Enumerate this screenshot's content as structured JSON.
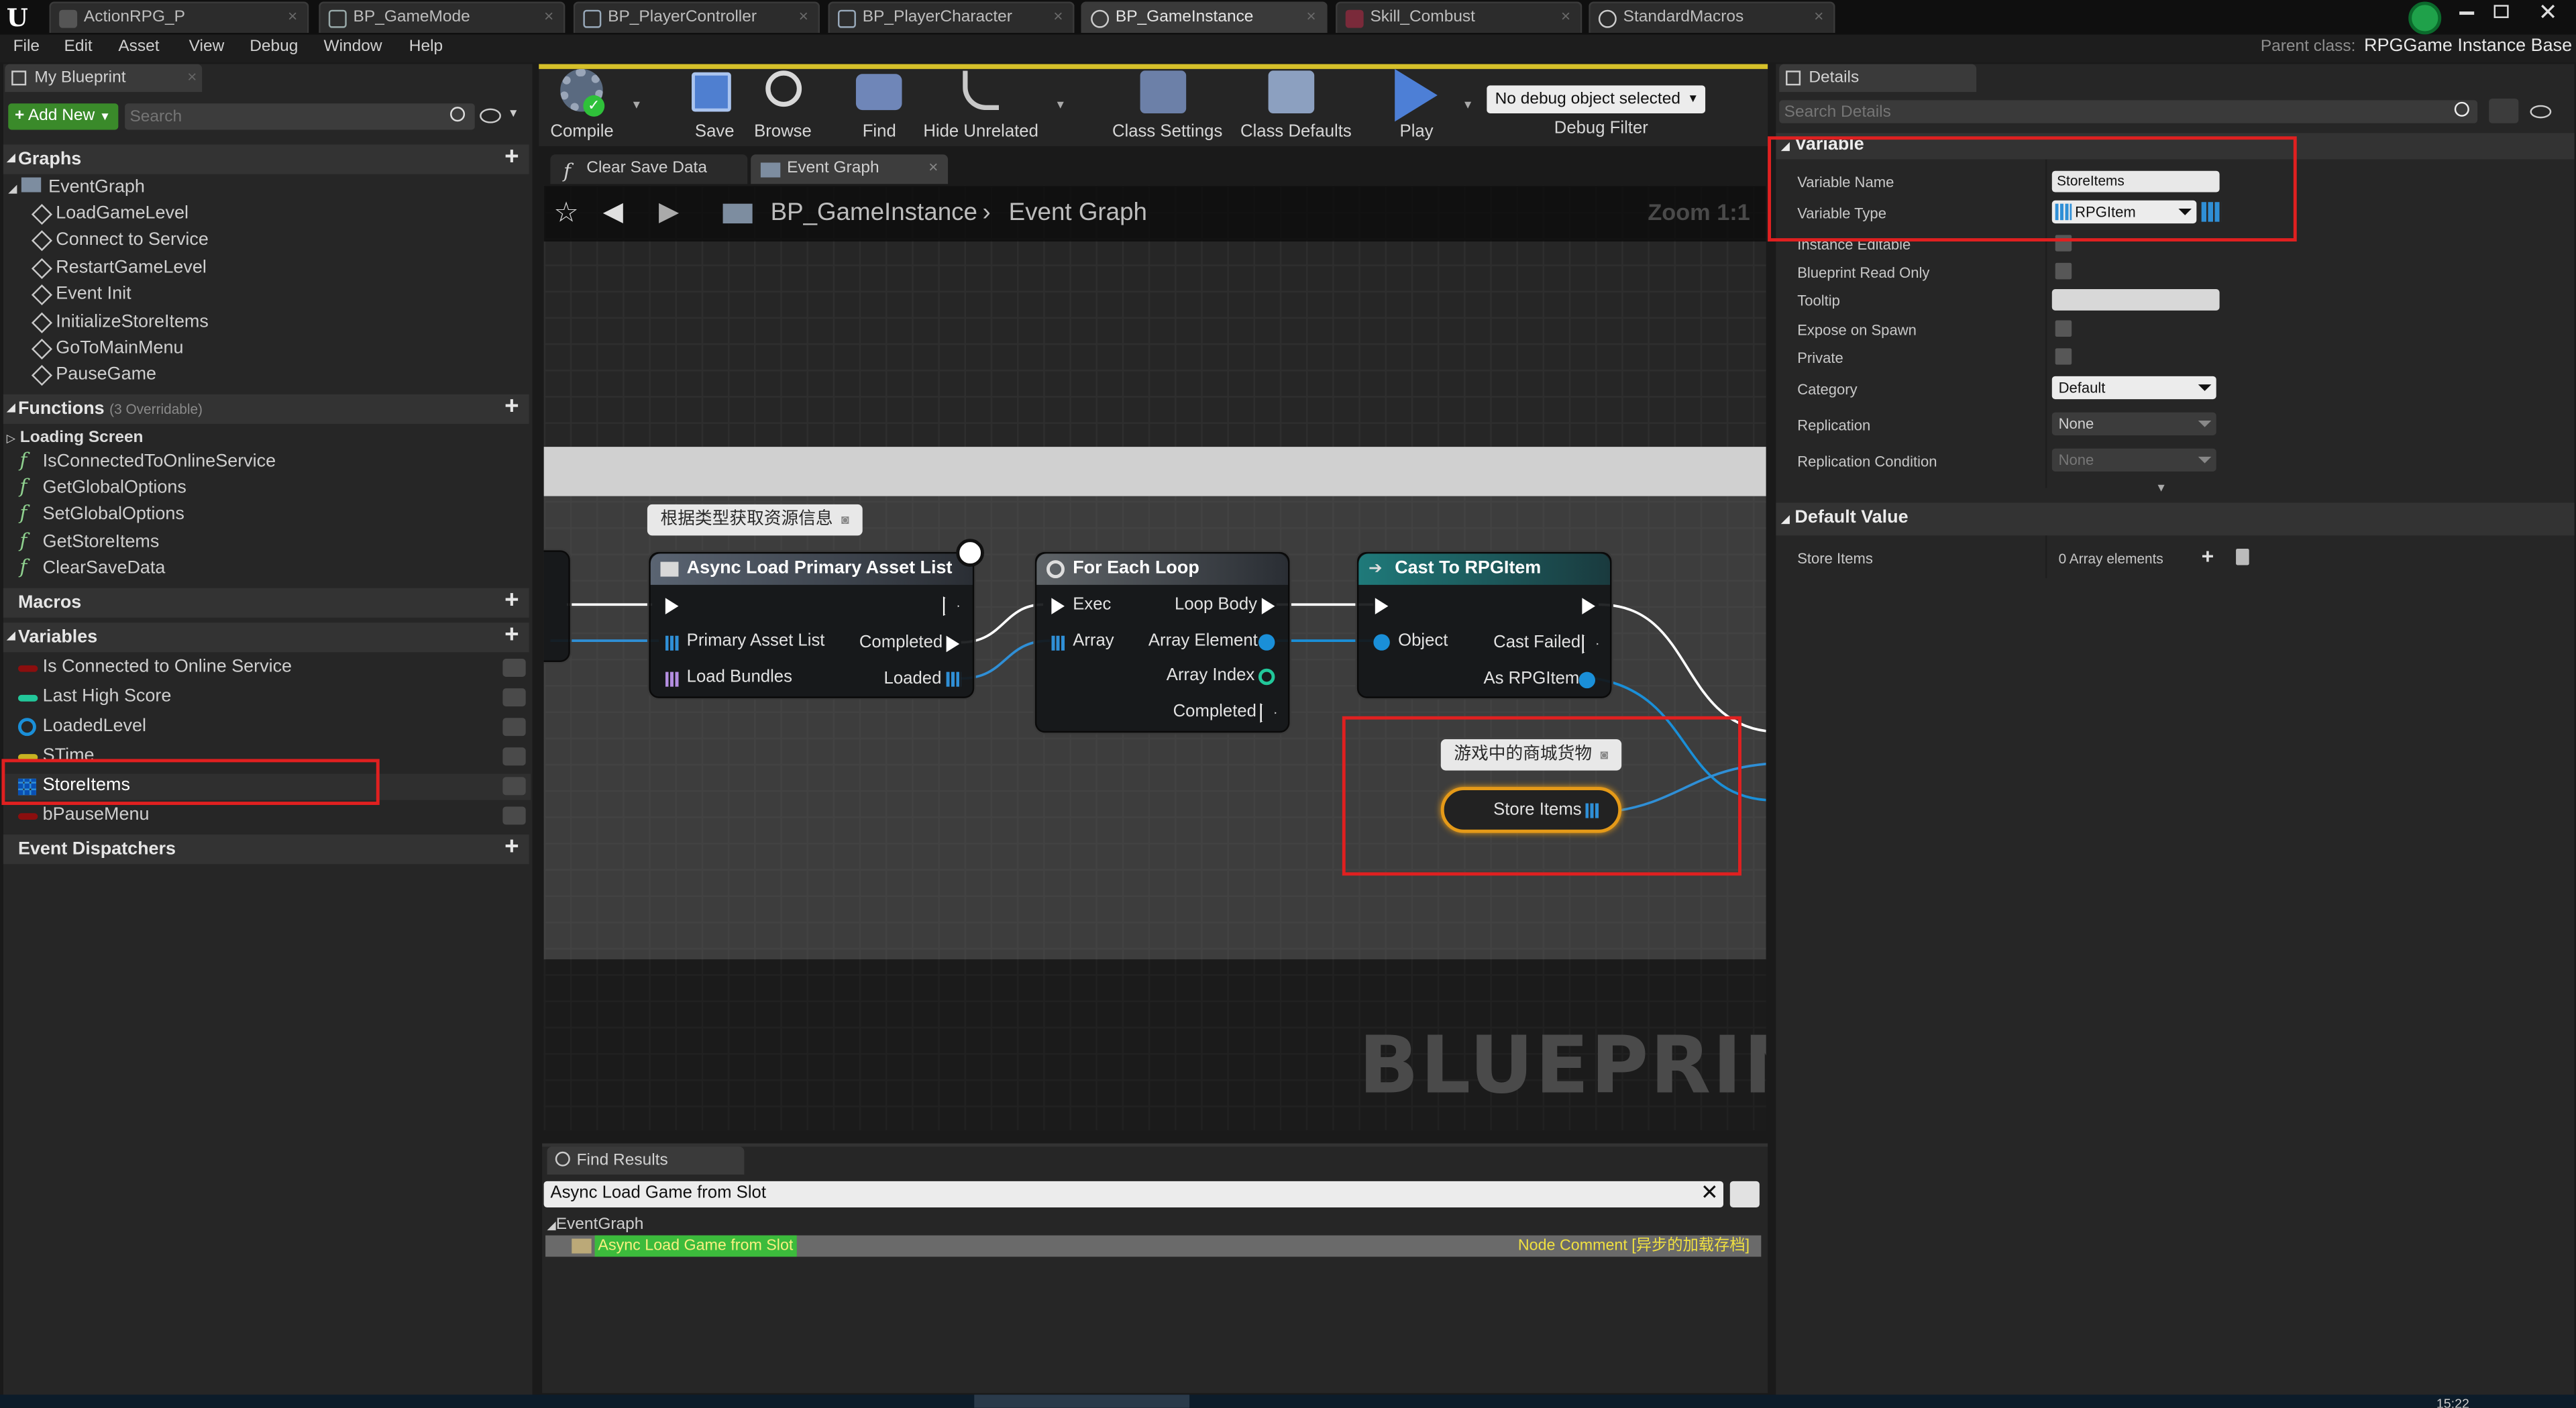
{
  "editor_tabs": [
    {
      "label": "ActionRPG_P"
    },
    {
      "label": "BP_GameMode"
    },
    {
      "label": "BP_PlayerController"
    },
    {
      "label": "BP_PlayerCharacter"
    },
    {
      "label": "BP_GameInstance"
    },
    {
      "label": "Skill_Combust"
    },
    {
      "label": "StandardMacros"
    }
  ],
  "menu": [
    "File",
    "Edit",
    "Asset",
    "View",
    "Debug",
    "Window",
    "Help"
  ],
  "parent_class": {
    "label": "Parent class:",
    "value": "RPGGame Instance Base"
  },
  "my_blueprint": {
    "tab": "My Blueprint",
    "add_new": "Add New",
    "search_placeholder": "Search",
    "graphs": {
      "title": "Graphs",
      "event_graph": "EventGraph",
      "items": [
        "LoadGameLevel",
        "Connect to Service",
        "RestartGameLevel",
        "Event Init",
        "InitializeStoreItems",
        "GoToMainMenu",
        "PauseGame"
      ]
    },
    "functions": {
      "title": "Functions",
      "note": "(3 Overridable)",
      "category": "Loading Screen",
      "items": [
        "IsConnectedToOnlineService",
        "GetGlobalOptions",
        "SetGlobalOptions",
        "GetStoreItems",
        "ClearSaveData"
      ]
    },
    "macros": {
      "title": "Macros"
    },
    "variables": {
      "title": "Variables",
      "items": [
        {
          "name": "Is Connected to Online Service",
          "color": "#8b0e0e"
        },
        {
          "name": "Last High Score",
          "color": "#22c79a"
        },
        {
          "name": "LoadedLevel",
          "color": "#1a8fd8"
        },
        {
          "name": "STime",
          "color": "#c7b322"
        },
        {
          "name": "StoreItems",
          "color": "#2f8fd6"
        },
        {
          "name": "bPauseMenu",
          "color": "#8b0e0e"
        }
      ]
    },
    "event_dispatchers": {
      "title": "Event Dispatchers"
    }
  },
  "toolbar": {
    "compile": "Compile",
    "save": "Save",
    "browse": "Browse",
    "find": "Find",
    "hide_unrelated": "Hide Unrelated",
    "class_settings": "Class Settings",
    "class_defaults": "Class Defaults",
    "play": "Play",
    "debug_select": "No debug object selected",
    "debug_filter": "Debug Filter"
  },
  "graph_tabs": [
    "Clear Save Data",
    "Event Graph"
  ],
  "graph": {
    "breadcrumb_bp": "BP_GameInstance",
    "breadcrumb_graph": "Event Graph",
    "zoom": "Zoom 1:1",
    "watermark": "BLUEPRINT",
    "comment_1": "根据类型获取资源信息",
    "comment_2": "游戏中的商城货物",
    "nodes": {
      "async_load": {
        "title": "Async Load Primary Asset List",
        "pin_list": "Primary Asset List",
        "pin_bundles": "Load Bundles",
        "out_completed": "Completed",
        "out_loaded": "Loaded"
      },
      "foreach": {
        "title": "For Each Loop",
        "exec": "Exec",
        "array": "Array",
        "loop_body": "Loop Body",
        "element": "Array Element",
        "index": "Array Index",
        "completed": "Completed"
      },
      "cast": {
        "title": "Cast To RPGItem",
        "object": "Object",
        "failed": "Cast Failed",
        "as_item": "As RPGItem"
      },
      "store_items": {
        "label": "Store Items"
      }
    }
  },
  "find_results": {
    "tab": "Find Results",
    "query": "Async Load Game from Slot",
    "group": "EventGraph",
    "result": "Async Load Game from Slot",
    "result_note": "Node Comment [异步的加载存档]"
  },
  "details": {
    "tab": "Details",
    "search_placeholder": "Search Details",
    "variable_section": "Variable",
    "rows": {
      "variable_name": "Variable Name",
      "variable_type": "Variable Type",
      "instance_editable": "Instance Editable",
      "read_only": "Blueprint Read Only",
      "tooltip": "Tooltip",
      "expose": "Expose on Spawn",
      "private": "Private",
      "category": "Category",
      "replication": "Replication",
      "replication_condition": "Replication Condition"
    },
    "values": {
      "variable_name": "StoreItems",
      "variable_type": "RPGItem",
      "category": "Default",
      "replication": "None",
      "replication_condition": "None"
    },
    "default_section": "Default Value",
    "default_row": "Store Items",
    "default_value": "0 Array elements"
  },
  "taskbar": {
    "time": "15:22"
  }
}
